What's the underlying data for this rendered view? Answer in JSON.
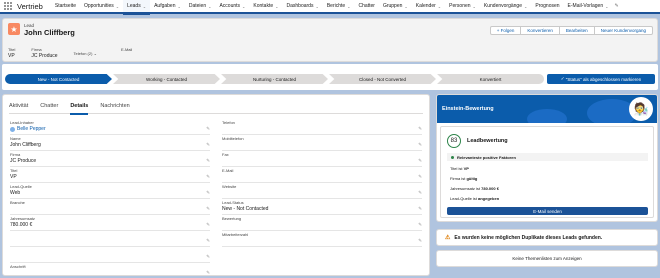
{
  "nav": {
    "app_name": "Vertrieb",
    "items": [
      {
        "label": "Startseite",
        "chev": false
      },
      {
        "label": "Opportunities",
        "chev": true
      },
      {
        "label": "Leads",
        "chev": true
      },
      {
        "label": "Aufgaben",
        "chev": true
      },
      {
        "label": "Dateien",
        "chev": true
      },
      {
        "label": "Accounts",
        "chev": true
      },
      {
        "label": "Kontakte",
        "chev": true
      },
      {
        "label": "Dashboards",
        "chev": true
      },
      {
        "label": "Berichte",
        "chev": true
      },
      {
        "label": "Chatter",
        "chev": false
      },
      {
        "label": "Gruppen",
        "chev": true
      },
      {
        "label": "Kalender",
        "chev": true
      },
      {
        "label": "Personen",
        "chev": true
      },
      {
        "label": "Kundenvorgänge",
        "chev": true
      },
      {
        "label": "Prognosen",
        "chev": false
      },
      {
        "label": "E-Mail-Vorlagen",
        "chev": true
      }
    ],
    "active_index": 2
  },
  "header": {
    "object_label": "Lead",
    "record_name": "John Cliffberg",
    "buttons": [
      "+ Folgen",
      "Konvertieren",
      "Bearbeiten",
      "Neuer Kundenvorgang"
    ],
    "fields": [
      {
        "label": "Titel",
        "value": "VP"
      },
      {
        "label": "Firma",
        "value": "JC Produce"
      },
      {
        "label": "Telefon (2)",
        "value": ""
      },
      {
        "label": "E-Mail",
        "value": ""
      }
    ]
  },
  "path": {
    "steps": [
      "New - Not Contacted",
      "Working - Contacted",
      "Nurturing - Contacted",
      "Closed - Not Converted",
      "Konvertiert"
    ],
    "mark_button": "\"Status\" als abgeschlossen markieren"
  },
  "tabs": [
    "Aktivität",
    "Chatter",
    "Details",
    "Nachrichten"
  ],
  "active_tab": 2,
  "details": {
    "left": [
      {
        "label": "Lead-Inhaber",
        "value": "Belle Pepper",
        "link": true
      },
      {
        "label": "Name",
        "value": "John Cliffberg"
      },
      {
        "label": "Firma",
        "value": "JC Produce"
      },
      {
        "label": "Titel",
        "value": "VP"
      },
      {
        "label": "Lead-Quelle",
        "value": "Web"
      },
      {
        "label": "Branche",
        "value": ""
      },
      {
        "label": "Jahresumsatz",
        "value": "780.000 €"
      },
      {
        "label": "",
        "value": ""
      },
      {
        "label": "",
        "value": ""
      },
      {
        "label": "Anschrift",
        "value": ""
      }
    ],
    "right": [
      {
        "label": "Telefon",
        "value": ""
      },
      {
        "label": "Mobiltelefon",
        "value": ""
      },
      {
        "label": "Fax",
        "value": ""
      },
      {
        "label": "E-Mail",
        "value": ""
      },
      {
        "label": "Website",
        "value": ""
      },
      {
        "label": "Lead-Status",
        "value": "New - Not Contacted"
      },
      {
        "label": "Bewertung",
        "value": ""
      },
      {
        "label": "Mitarbeiterzahl",
        "value": ""
      }
    ]
  },
  "einstein": {
    "title": "Einstein-Bewertung",
    "score": "83",
    "score_title": "Leadbewertung",
    "factors_title": "Relevanteste positive Faktoren",
    "factors": [
      {
        "prefix": "Titel ist ",
        "bold": "VP"
      },
      {
        "prefix": "Firma ist ",
        "bold": "gültig"
      },
      {
        "prefix": "Jahresumsatz ist ",
        "bold": "780.000 €"
      },
      {
        "prefix": "Lead-Quelle ist ",
        "bold": "angegeben"
      }
    ],
    "email_button": "E-Mail senden"
  },
  "duplicates": "Es wurden keine möglichen Duplikate dieses Leads gefunden.",
  "topics_button": "Keine Themenlisten zum Anzeigen"
}
